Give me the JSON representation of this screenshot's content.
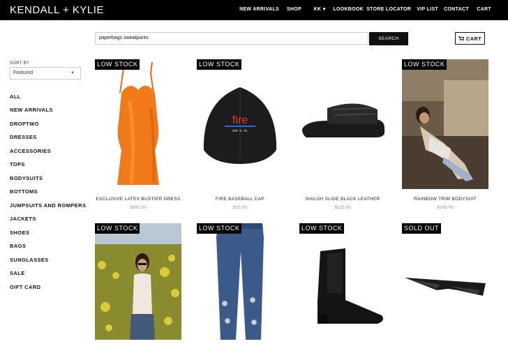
{
  "brand": "KENDALL + KYLIE",
  "nav": {
    "new_arrivals": "NEW ARRIVALS",
    "shop": "SHOP",
    "kk": "KK ♥",
    "lookbook": "LOOKBOOK",
    "store_locator": "STORE LOCATOR",
    "vip_list": "VIP LIST",
    "contact": "CONTACT",
    "cart": "CART"
  },
  "search": {
    "value": "paperbags sweatpants",
    "button": "SEARCH"
  },
  "cart_button": "CART",
  "sort": {
    "label": "SORT BY",
    "selected": "Featured"
  },
  "categories": [
    "ALL",
    "NEW ARRIVALS",
    "DROPTWO",
    "DRESSES",
    "ACCESSORIES",
    "TOPS",
    "BODYSUITS",
    "BOTTOMS",
    "JUMPSUITS AND ROMPERS",
    "JACKETS",
    "SHOES",
    "BAGS",
    "SUNGLASSES",
    "SALE",
    "GIFT CARD"
  ],
  "products": [
    {
      "badge": "LOW STOCK",
      "name": "EXCLUSIVE LATEX BUSTIER DRESS",
      "price": "$395.00",
      "icon": "orange-dress"
    },
    {
      "badge": "LOW STOCK",
      "name": "FIRE BASEBALL CAP",
      "price": "$25.00",
      "icon": "black-cap"
    },
    {
      "badge": "",
      "name": "SHILOH SLIDE BLACK LEATHER",
      "price": "$125.00",
      "icon": "black-slide"
    },
    {
      "badge": "LOW STOCK",
      "name": "RAINBOW TRIM BODYSUIT",
      "price": "$145.00",
      "icon": "model-car-photo"
    },
    {
      "badge": "LOW STOCK",
      "name": "",
      "price": "",
      "icon": "model-field-photo"
    },
    {
      "badge": "LOW STOCK",
      "name": "",
      "price": "",
      "icon": "denim-jeans"
    },
    {
      "badge": "LOW STOCK",
      "name": "",
      "price": "",
      "icon": "black-bootie"
    },
    {
      "badge": "SOLD OUT",
      "name": "",
      "price": "",
      "icon": "black-sunglasses"
    }
  ]
}
